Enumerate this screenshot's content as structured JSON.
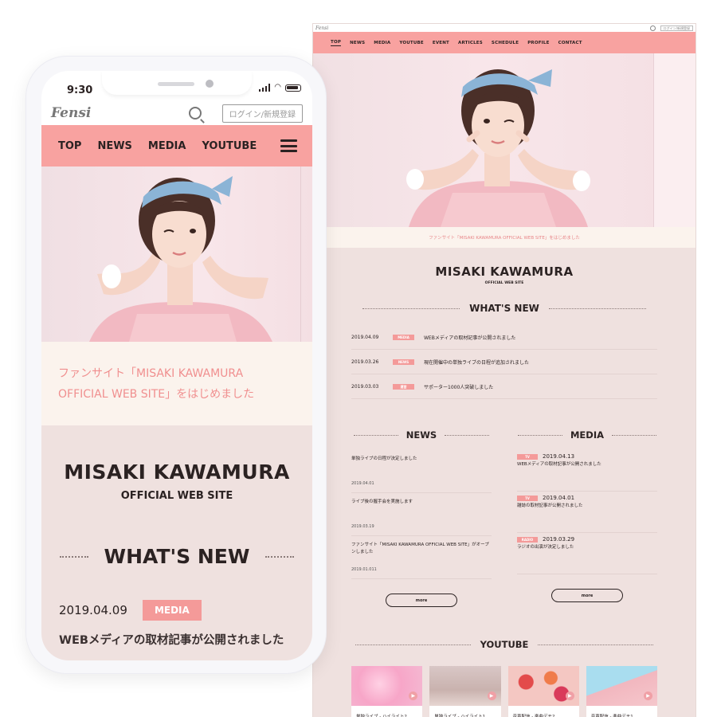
{
  "desktop": {
    "logo": "Fensi",
    "login_label": "ログイン/新規登録",
    "nav": [
      "TOP",
      "NEWS",
      "MEDIA",
      "YOUTUBE",
      "EVENT",
      "ARTICLES",
      "SCHEDULE",
      "PROFILE",
      "CONTACT"
    ],
    "caption": "ファンサイト「MISAKI KAWAMURA OFFICIAL WEB SITE」をはじめました",
    "site_title": "MISAKI KAWAMURA",
    "site_subtitle": "OFFICIAL WEB SITE",
    "whats_new": {
      "heading": "WHAT'S NEW",
      "items": [
        {
          "date": "2019.04.09",
          "tag": "MEDIA",
          "text": "WEBメディアの取材記事が公開されました"
        },
        {
          "date": "2019.03.26",
          "tag": "NEWS",
          "text": "現在開催中の単独ライブの日程が追加されました"
        },
        {
          "date": "2019.03.03",
          "tag": "運営",
          "text": "サポーター1000人突破しました"
        }
      ]
    },
    "news": {
      "heading": "NEWS",
      "items": [
        {
          "text": "単独ライブの日程が決定しました",
          "date": "2019.04.01"
        },
        {
          "text": "ライブ後の握手会を実施します",
          "date": "2019.03.19"
        },
        {
          "text": "ファンサイト「MISAKI KAWAMURA OFFICIAL WEB SITE」がオープンしました",
          "date": "2019.01.011"
        }
      ],
      "more_label": "more"
    },
    "media": {
      "heading": "MEDIA",
      "items": [
        {
          "tag": "TV",
          "date": "2019.04.13",
          "text": "WEBメディアの取材記事が公開されました"
        },
        {
          "tag": "TV",
          "date": "2019.04.01",
          "text": "雑誌の取材記事が公開されました"
        },
        {
          "tag": "RADIO",
          "date": "2019.03.29",
          "text": "ラジオの出演が決定しました"
        }
      ],
      "more_label": "more"
    },
    "youtube": {
      "heading": "YOUTUBE",
      "videos": [
        {
          "title": "単独ライブ - ハイライト2",
          "thumb": "pink-smoke"
        },
        {
          "title": "単独ライブ - ハイライト1",
          "thumb": "hands"
        },
        {
          "title": "音声配信 - 楽曲デモ2",
          "thumb": "fruit"
        },
        {
          "title": "音声配信 - 楽曲デモ1",
          "thumb": "building"
        }
      ]
    }
  },
  "mobile": {
    "time": "9:30",
    "logo": "Fensi",
    "login_label": "ログイン/新規登録",
    "nav": [
      "TOP",
      "NEWS",
      "MEDIA",
      "YOUTUBE"
    ],
    "caption": "ファンサイト「MISAKI KAWAMURA OFFICIAL WEB SITE」をはじめました",
    "site_title": "MISAKI KAWAMURA",
    "site_subtitle": "OFFICIAL WEB SITE",
    "whats_new_heading": "WHAT'S NEW",
    "first_item": {
      "date": "2019.04.09",
      "tag": "MEDIA",
      "text": "WEBメディアの取材記事が公開されました"
    }
  },
  "colors": {
    "accent": "#f8a2a0",
    "tag": "#f49a99",
    "caption_text": "#f08f8f",
    "background": "#efe1df",
    "text": "#2b2222"
  }
}
